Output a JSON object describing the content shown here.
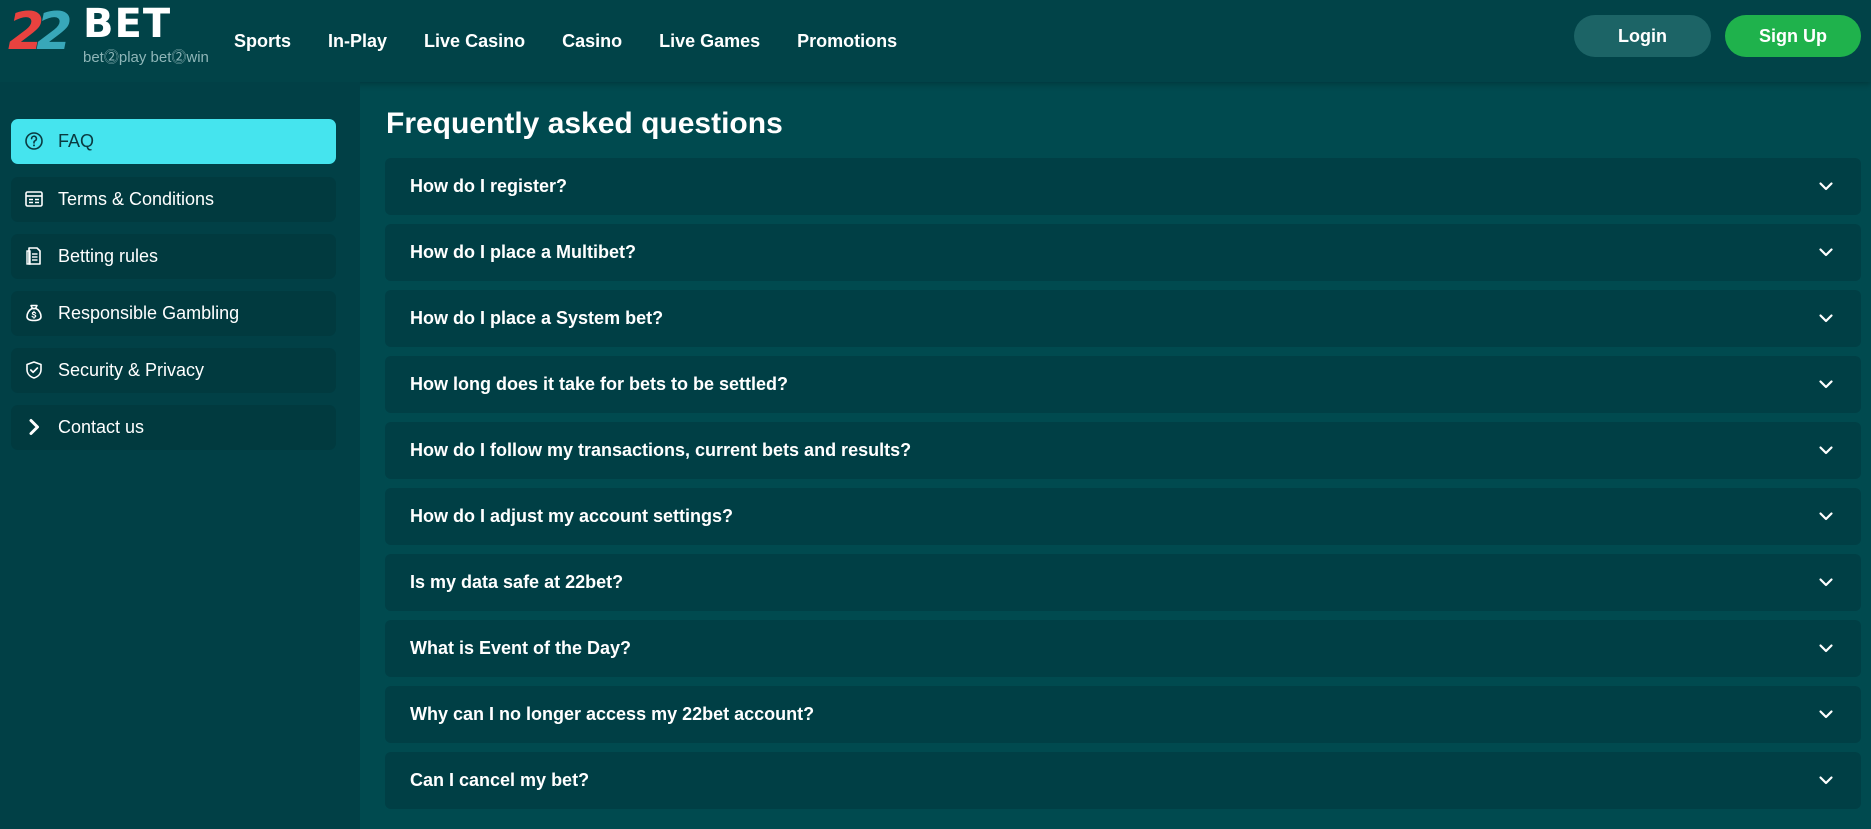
{
  "brand": {
    "logo_number": "22",
    "logo_word": "BET",
    "tagline": "bet⓶play  bet⓶win",
    "colors": {
      "red": "#e8423f",
      "teal": "#38a7b9",
      "accent": "#45e4ee",
      "signup_green": "#1fb24c"
    }
  },
  "nav": {
    "items": [
      {
        "label": "Sports"
      },
      {
        "label": "In-Play"
      },
      {
        "label": "Live Casino"
      },
      {
        "label": "Casino"
      },
      {
        "label": "Live Games"
      },
      {
        "label": "Promotions"
      }
    ],
    "login_label": "Login",
    "signup_label": "Sign Up"
  },
  "sidebar": {
    "items": [
      {
        "label": "FAQ",
        "icon": "question-circle-icon",
        "active": true
      },
      {
        "label": "Terms & Conditions",
        "icon": "document-list-icon",
        "active": false
      },
      {
        "label": "Betting rules",
        "icon": "rules-sheet-icon",
        "active": false
      },
      {
        "label": "Responsible Gambling",
        "icon": "money-bag-icon",
        "active": false
      },
      {
        "label": "Security & Privacy",
        "icon": "shield-check-icon",
        "active": false
      },
      {
        "label": "Contact us",
        "icon": "chevron-right-icon",
        "active": false
      }
    ]
  },
  "main": {
    "title": "Frequently asked questions",
    "faqs": [
      {
        "question": "How do I register?"
      },
      {
        "question": "How do I place a Multibet?"
      },
      {
        "question": "How do I place a System bet?"
      },
      {
        "question": "How long does it take for bets to be settled?"
      },
      {
        "question": "How do I follow my transactions, current bets and results?"
      },
      {
        "question": "How do I adjust my account settings?"
      },
      {
        "question": "Is my data safe at 22bet?"
      },
      {
        "question": "What is Event of the Day?"
      },
      {
        "question": "Why can I no longer access my 22bet account?"
      },
      {
        "question": "Can I cancel my bet?"
      }
    ]
  }
}
